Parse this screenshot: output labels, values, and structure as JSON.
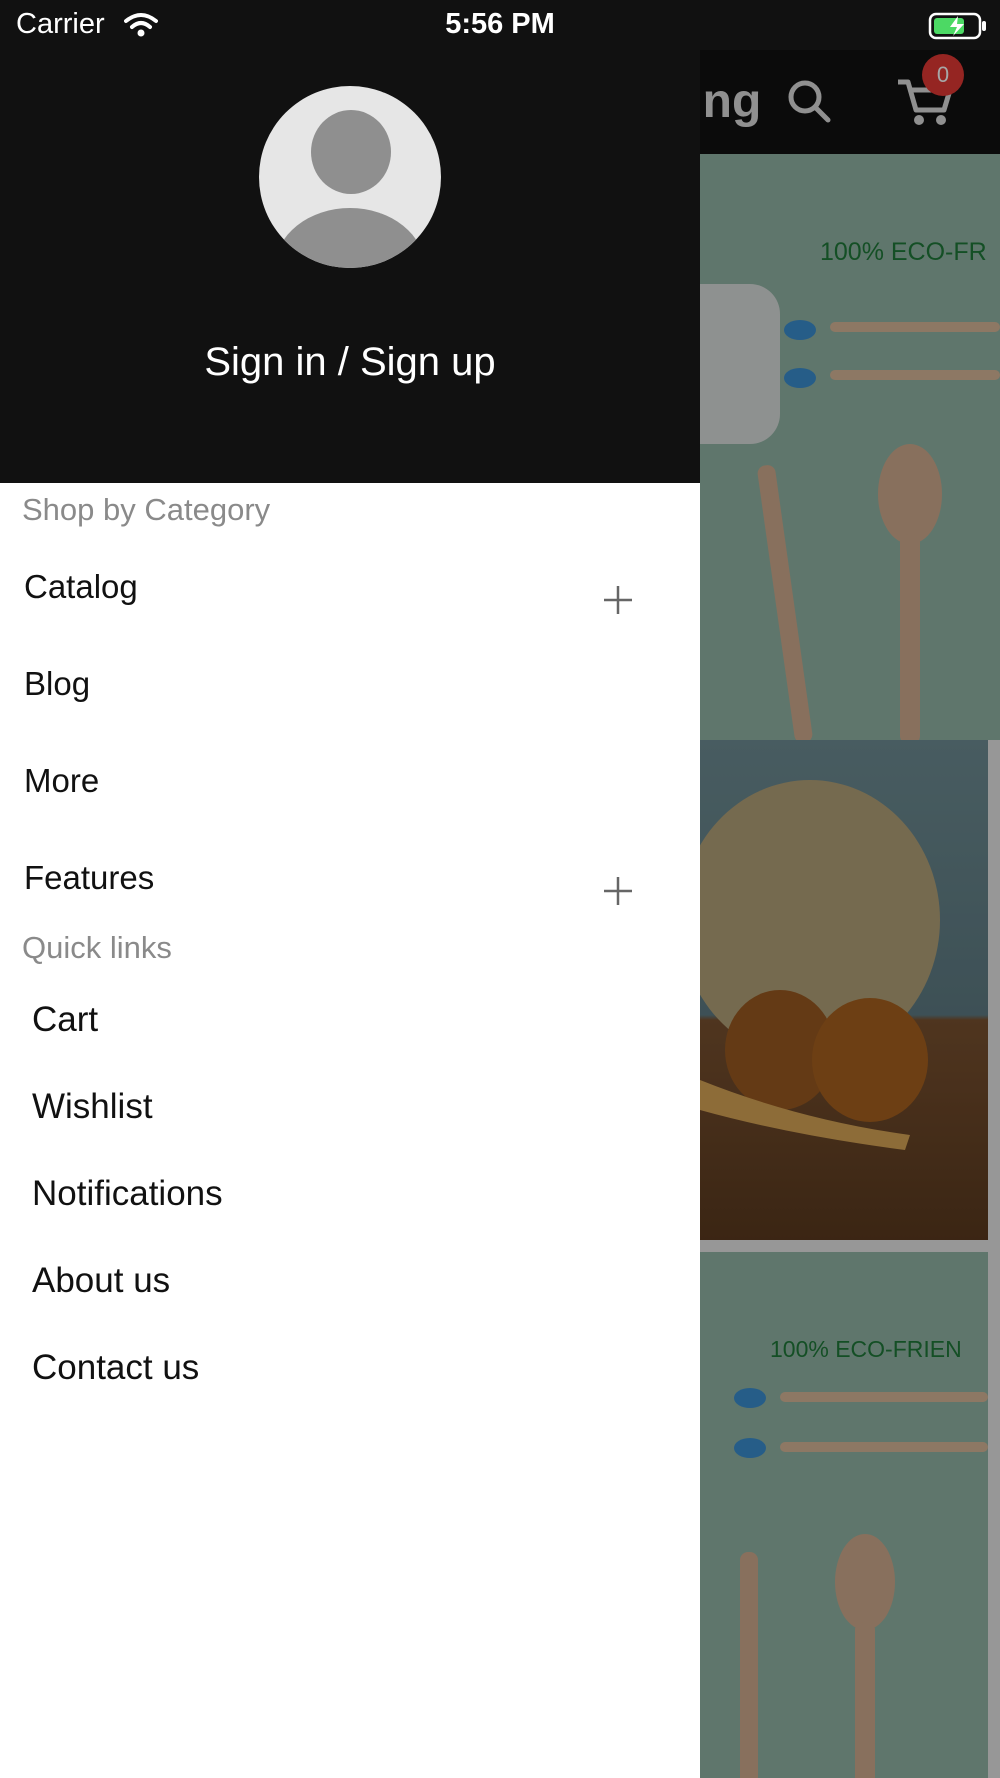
{
  "status_bar": {
    "carrier": "Carrier",
    "time": "5:56 PM"
  },
  "app": {
    "header_title_partial": "ping",
    "cart_count": "0",
    "banner1_text": "100% ECO-FR",
    "banner2_text": "100% ECO-FRIEN"
  },
  "drawer": {
    "sign_in_label": "Sign in / Sign up",
    "shop_by_category_label": "Shop by Category",
    "categories": [
      {
        "label": "Catalog",
        "expandable": true
      },
      {
        "label": "Blog",
        "expandable": false
      },
      {
        "label": "More",
        "expandable": false
      },
      {
        "label": "Features",
        "expandable": true
      }
    ],
    "quick_links_label": "Quick links",
    "quick_links": [
      "Cart",
      "Wishlist",
      "Notifications",
      "About us",
      "Contact us"
    ]
  },
  "colors": {
    "drawer_header": "#111111",
    "badge": "#e53935",
    "banner_text": "#1f7a3a"
  }
}
